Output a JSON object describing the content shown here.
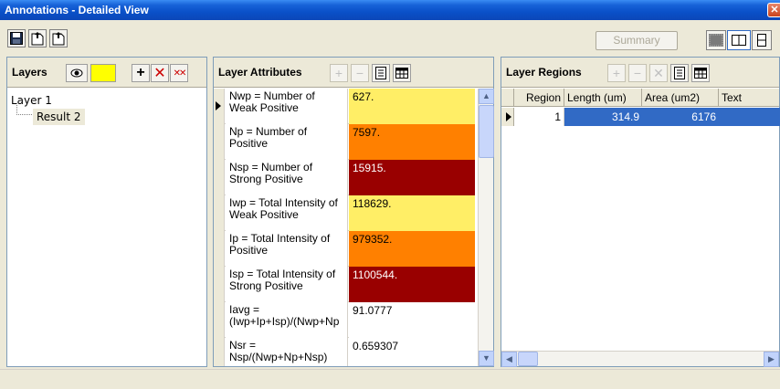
{
  "window": {
    "title": "Annotations - Detailed View"
  },
  "toolbar": {
    "summary_label": "Summary"
  },
  "layers": {
    "title": "Layers",
    "swatch_color": "#ffff00",
    "tree": {
      "root": "Layer 1",
      "child": "Result 2"
    }
  },
  "attributes": {
    "title": "Layer Attributes",
    "rows": [
      {
        "name": "Nwp = Number of Weak Positive",
        "value": "627.",
        "color": "#ffee66"
      },
      {
        "name": "Np  = Number of Positive",
        "value": "7597.",
        "color": "#ff8000"
      },
      {
        "name": "Nsp = Number of Strong Positive",
        "value": "15915.",
        "color": "#990000"
      },
      {
        "name": "Iwp = Total Intensity of Weak Positive",
        "value": "118629.",
        "color": "#ffee66"
      },
      {
        "name": "Ip  = Total Intensity of Positive",
        "value": "979352.",
        "color": "#ff8000"
      },
      {
        "name": "Isp = Total Intensity of Strong Positive",
        "value": "1100544.",
        "color": "#990000"
      },
      {
        "name": "Iavg = (Iwp+Ip+Isp)/(Nwp+Np",
        "value": "91.0777",
        "color": "#ffffff"
      },
      {
        "name": "Nsr = Nsp/(Nwp+Np+Nsp)",
        "value": "0.659307",
        "color": "#ffffff"
      }
    ]
  },
  "regions": {
    "title": "Layer Regions",
    "columns": [
      "Region",
      "Length (um)",
      "Area (um2)",
      "Text"
    ],
    "rows": [
      {
        "region": "1",
        "length": "314.9",
        "area": "6176",
        "text": ""
      }
    ],
    "selected_color": "#316ac5"
  }
}
